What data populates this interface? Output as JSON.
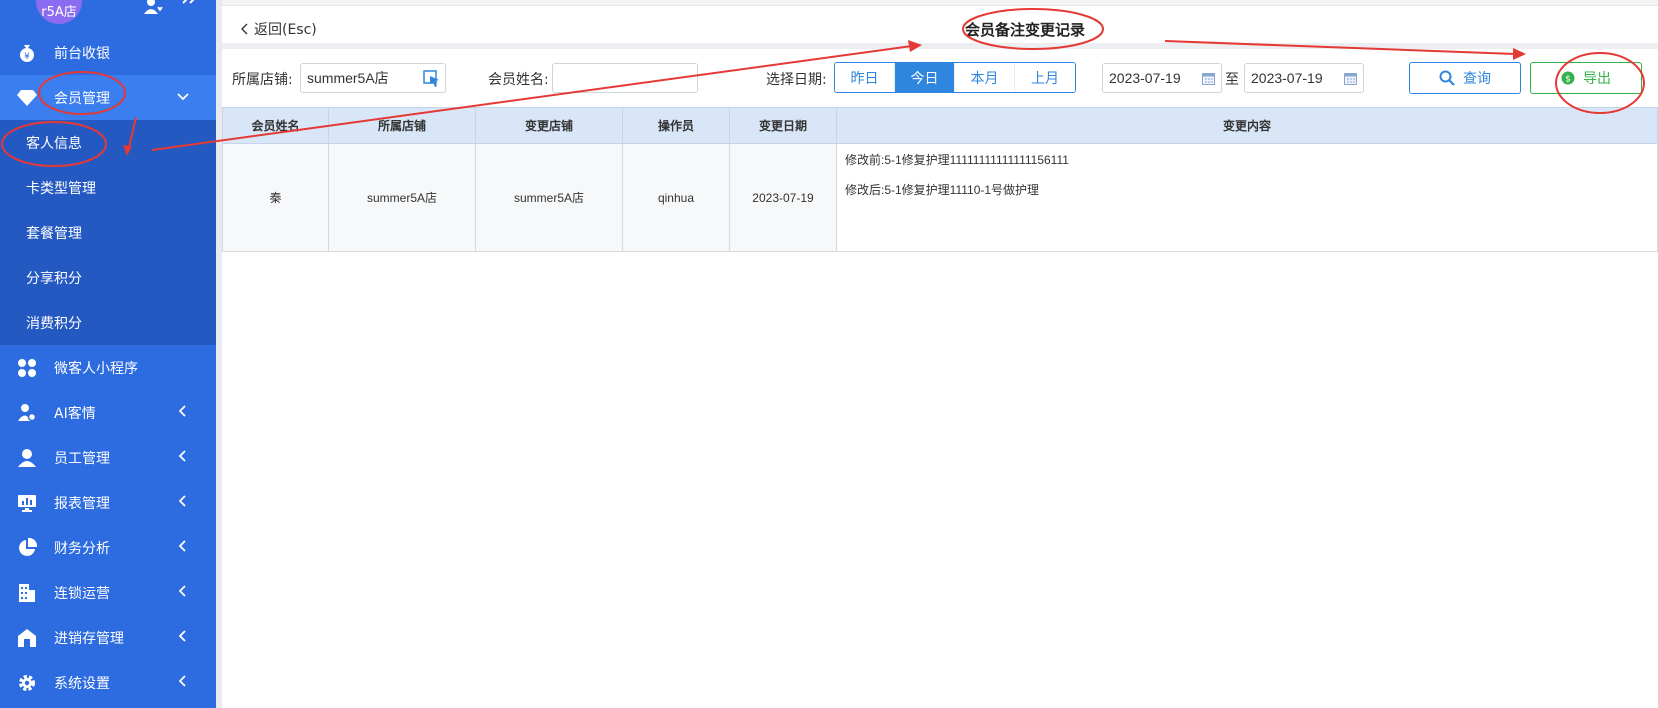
{
  "store": {
    "avatar_text": "r5A店"
  },
  "sidebar": {
    "items": [
      {
        "label": "前台收银",
        "icon": "money-bag-icon"
      },
      {
        "label": "会员管理",
        "icon": "diamond-icon"
      },
      {
        "label": "微客人小程序",
        "icon": "grid-clover-icon"
      },
      {
        "label": "AI客情",
        "icon": "user-gear-icon"
      },
      {
        "label": "员工管理",
        "icon": "user-icon"
      },
      {
        "label": "报表管理",
        "icon": "monitor-chart-icon"
      },
      {
        "label": "财务分析",
        "icon": "pie-chart-icon"
      },
      {
        "label": "连锁运营",
        "icon": "building-icon"
      },
      {
        "label": "进销存管理",
        "icon": "warehouse-icon"
      },
      {
        "label": "系统设置",
        "icon": "gear-icon"
      }
    ],
    "submenu": [
      "客人信息",
      "卡类型管理",
      "套餐管理",
      "分享积分",
      "消费积分"
    ]
  },
  "header": {
    "back_label": "返回(Esc)",
    "title": "会员备注变更记录"
  },
  "filters": {
    "store_label": "所属店铺:",
    "store_value": "summer5A店",
    "member_label": "会员姓名:",
    "member_value": "",
    "date_label": "选择日期:",
    "date_buttons": [
      "昨日",
      "今日",
      "本月",
      "上月"
    ],
    "date_from": "2023-07-19",
    "date_sep": "至",
    "date_to": "2023-07-19",
    "query_label": "查询",
    "export_label": "导出"
  },
  "table": {
    "columns": [
      "会员姓名",
      "所属店铺",
      "变更店铺",
      "操作员",
      "变更日期",
      "变更内容"
    ],
    "rows": [
      {
        "name": "秦",
        "store": "summer5A店",
        "change_store": "summer5A店",
        "operator": "qinhua",
        "date": "2023-07-19",
        "before": "修改前:5-1修复护理11111111111111156111",
        "after": "修改后:5-1修复护理11110-1号做护理"
      }
    ]
  },
  "colors": {
    "sidebar_bg": "#2d6be0",
    "accent": "#2e86de",
    "export_green": "#36b24a",
    "annotation_red": "#e53935"
  }
}
